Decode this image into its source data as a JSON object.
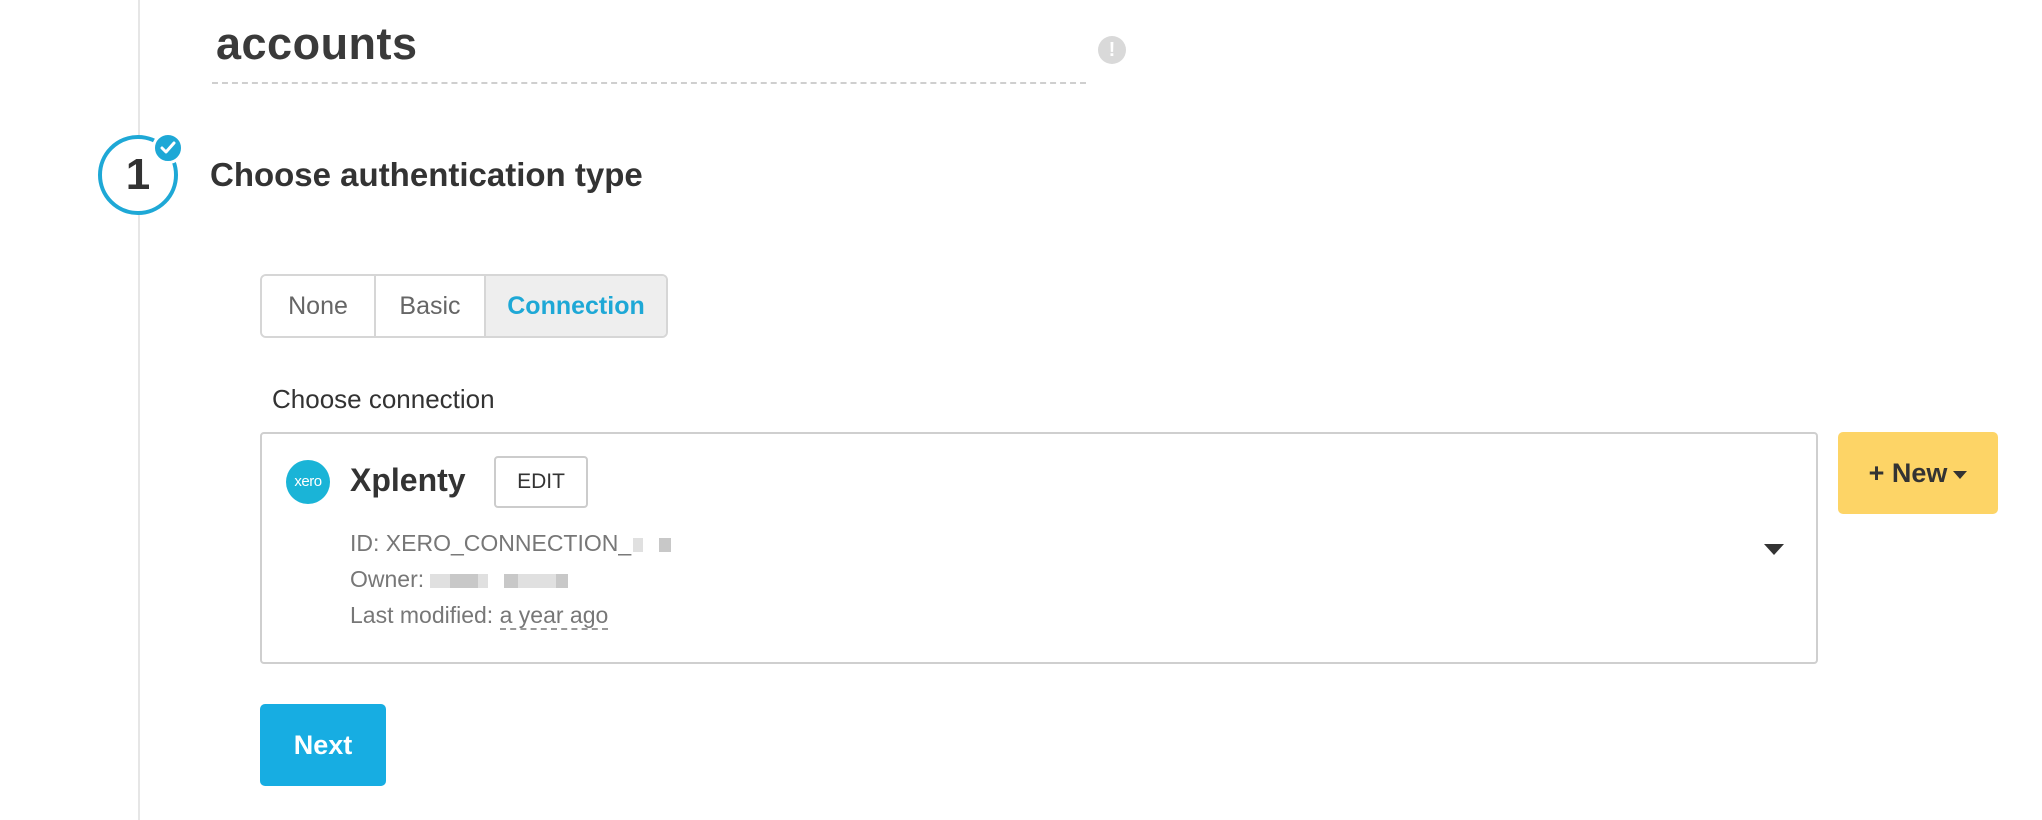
{
  "header": {
    "title": "accounts",
    "warning_icon": "exclamation-circle-icon"
  },
  "step": {
    "number": "1",
    "title": "Choose authentication type",
    "completed_icon": "check-icon"
  },
  "auth_tabs": [
    {
      "label": "None",
      "selected": false
    },
    {
      "label": "Basic",
      "selected": false
    },
    {
      "label": "Connection",
      "selected": true
    }
  ],
  "connection": {
    "section_label": "Choose connection",
    "logo_text": "xero",
    "name": "Xplenty",
    "edit_label": "EDIT",
    "id_text": "ID: XERO_CONNECTION_",
    "owner_label": "Owner:",
    "modified_label": "Last modified:",
    "modified_value": "a year ago"
  },
  "actions": {
    "new_label": "+ New",
    "next_label": "Next"
  },
  "colors": {
    "accent": "#1ea8d6",
    "new_button": "#fdd466",
    "next_button": "#17ade2"
  }
}
